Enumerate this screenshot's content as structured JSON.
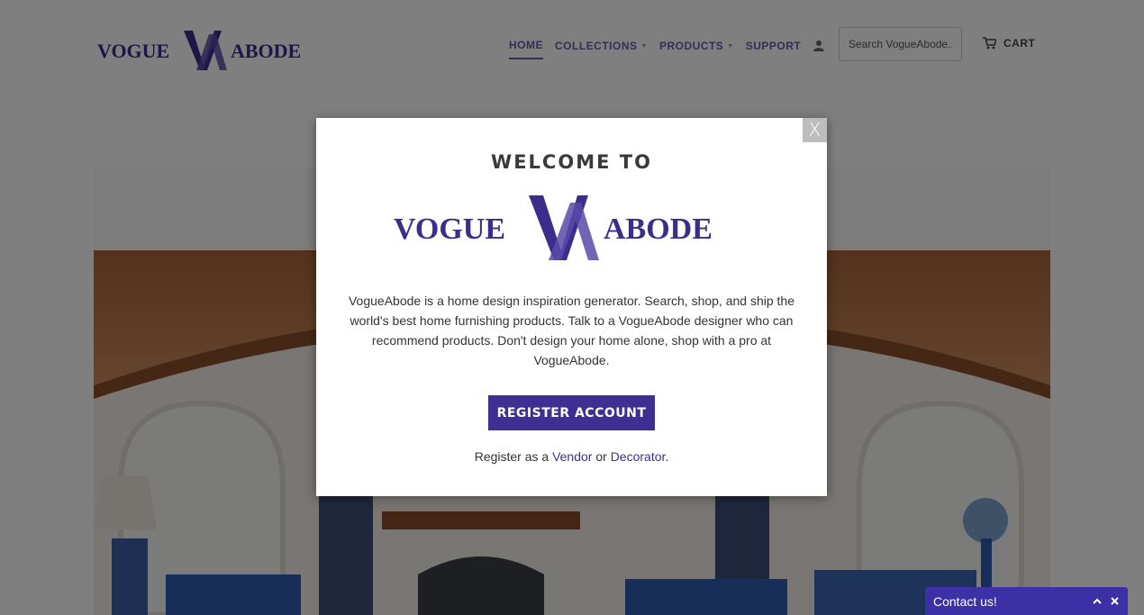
{
  "brand": {
    "logo_text_left": "VOGUE",
    "logo_text_right": "ABODE",
    "logo_monogram": "VA",
    "color_primary": "#3f2f93",
    "color_logo": "#3b2d8c"
  },
  "nav": {
    "items": [
      {
        "label": "HOME",
        "active": true,
        "dropdown": false
      },
      {
        "label": "COLLECTIONS",
        "active": false,
        "dropdown": true
      },
      {
        "label": "PRODUCTS",
        "active": false,
        "dropdown": true
      },
      {
        "label": "SUPPORT",
        "active": false,
        "dropdown": false
      }
    ],
    "user_icon": "user-icon",
    "search_placeholder": "Search VogueAbode...",
    "cart_icon": "cart-icon",
    "cart_label": "CART"
  },
  "modal": {
    "close_label": "X",
    "heading": "WELCOME TO",
    "description": "VogueAbode is a home design inspiration generator. Search, shop, and ship the world's best home furnishing products. Talk to a VogueAbode designer who can recommend products. Don't design your home alone, shop with a pro at VogueAbode.",
    "register_button": "REGISTER ACCOUNT",
    "footer_prefix": "Register as a",
    "footer_link_vendor": "Vendor",
    "footer_or": "or",
    "footer_link_decorator": "Decorator",
    "footer_suffix": "."
  },
  "chat": {
    "label": "Contact us!",
    "expand_icon": "chevron-up-icon",
    "close_icon": "close-icon",
    "color": "#3d30a6"
  }
}
